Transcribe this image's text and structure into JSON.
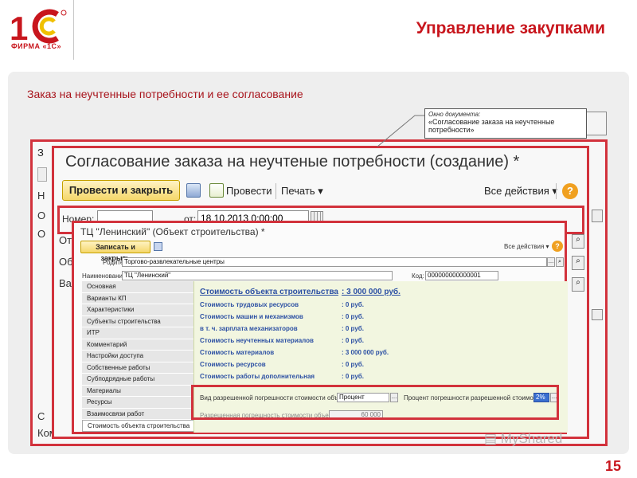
{
  "header": {
    "logo_text": "ФИРМА «1С»",
    "title": "Управление закупками",
    "subtitle": "Заказ на неучтенные потребности и ее согласование",
    "page_number": "15",
    "accent_color": "#c8161d"
  },
  "callout": {
    "caption": "Окно документа:",
    "text": "«Согласование заказа на неучтенные потребности»",
    "ghost_text": "сти»"
  },
  "base_window": {
    "title_fragment": "З",
    "rows": [
      "Н",
      "О",
      "О",
      "С",
      "Коммен"
    ]
  },
  "doc_window": {
    "title": "Согласование заказа на неучтеные потребности (создание) *",
    "toolbar": {
      "post_close": "Провести и закрыть",
      "post": "Провести",
      "print": "Печать",
      "all_actions": "Все действия",
      "help": "?"
    },
    "fields": {
      "number_label": "Номер:",
      "number_value": "",
      "date_label": "от:",
      "date_value": "18.10.2013  0:00:00"
    },
    "side_labels": [
      "От",
      "Об",
      "Ва"
    ]
  },
  "object_window": {
    "title": "ТЦ \"Ленинский\" (Объект строительства) *",
    "toolbar": {
      "save_close": "Записать и закрыть",
      "all_actions": "Все действия",
      "help": "?"
    },
    "parent_label": "Родитель:",
    "parent_value": "Торгово-развлекательные центры",
    "name_label": "Наименование:",
    "name_value": "ТЦ \"Ленинский\"",
    "code_label": "Код:",
    "code_value": "000000000000001",
    "tabs": [
      "Основная",
      "Варианты КП",
      "Характеристики",
      "Субъекты строительства",
      "ИТР",
      "Комментарий",
      "Настройки доступа",
      "Собственные работы",
      "Субподрядные работы",
      "Материалы",
      "Ресурсы",
      "Взаимосвязи работ",
      "Стоимость объекта строительства"
    ],
    "active_tab_index": 12,
    "cost_items": [
      {
        "label": "Стоимость объекта строительства",
        "value": ": 3 000 000 руб."
      },
      {
        "label": "Стоимость трудовых ресурсов",
        "value": ": 0 руб."
      },
      {
        "label": "Стоимость машин и механизмов",
        "value": ": 0 руб."
      },
      {
        "label": "в т. ч. зарплата механизаторов",
        "value": ": 0 руб."
      },
      {
        "label": "Стоимость неучтенных материалов",
        "value": ": 0 руб."
      },
      {
        "label": "Стоимость материалов",
        "value": ": 3 000 000 руб."
      },
      {
        "label": "Стоимость ресурсов",
        "value": ": 0 руб."
      },
      {
        "label": "Стоимость работы дополнительная",
        "value": ": 0 руб."
      }
    ],
    "tolerance": {
      "kind_label": "Вид разрешенной погрешности стоимости объекта:",
      "kind_value": "Процент",
      "percent_label": "Процент погрешности разрешенной стоимости:",
      "percent_value": "2%",
      "allowed_label": "Разрешенная погрешность стоимости объекта:",
      "allowed_value": "60 000"
    }
  },
  "watermark": "MyShared"
}
